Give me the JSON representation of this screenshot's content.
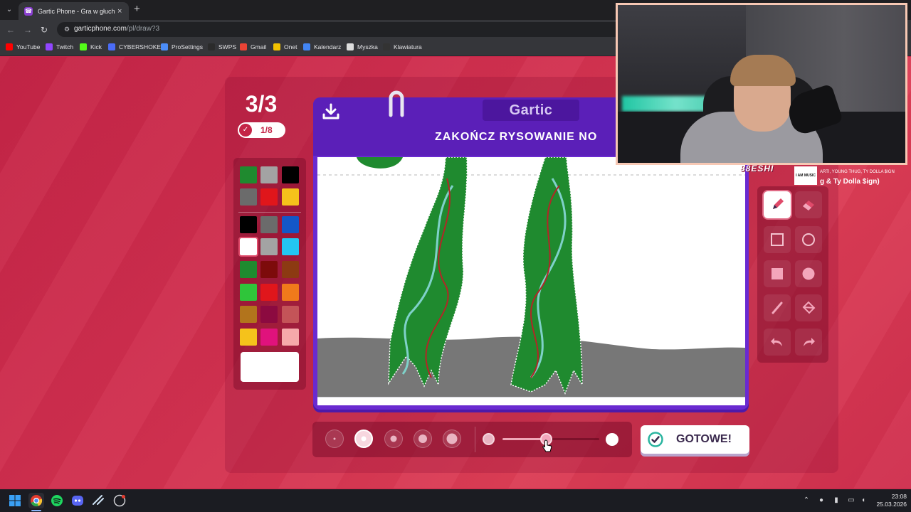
{
  "browser": {
    "tab_title": "Gartic Phone - Gra w głuchy te",
    "tab_close": "×",
    "new_tab": "+",
    "url_host": "garticphone.com",
    "url_path": "/pl/draw?3",
    "bookmarks": [
      {
        "label": "YouTube",
        "icon": "youtube-icon",
        "color": "#ff0000"
      },
      {
        "label": "Twitch",
        "icon": "twitch-icon",
        "color": "#9146ff"
      },
      {
        "label": "Kick",
        "icon": "kick-icon",
        "color": "#53fc18"
      },
      {
        "label": "CYBERSHOKE",
        "icon": "cybershoke-icon",
        "color": "#4a6cf7"
      },
      {
        "label": "ProSettings",
        "icon": "gear-icon",
        "color": "#4b8df8"
      },
      {
        "label": "SWPS",
        "icon": "swps-icon",
        "color": "#2b2b2b"
      },
      {
        "label": "Gmail",
        "icon": "gmail-icon",
        "color": "#ea4335"
      },
      {
        "label": "Onet",
        "icon": "onet-icon",
        "color": "#f2c200"
      },
      {
        "label": "Kalendarz",
        "icon": "calendar-icon",
        "color": "#4285f4"
      },
      {
        "label": "Myszka",
        "icon": "pen-icon",
        "color": "#dddddd"
      },
      {
        "label": "Klawiatura",
        "icon": "keyboard-icon",
        "color": "#333333"
      }
    ]
  },
  "game": {
    "round": "3/3",
    "done_count": "1/8",
    "logo": "Gartic",
    "task": "ZAKOŃCZ RYSOWANIE NO",
    "done_button": "GOTOWE!",
    "colors": {
      "brand_purple": "#6a2ad0",
      "background": "#c8284a"
    },
    "palette": [
      "#1f8a2f",
      "#a3a3a3",
      "#000000",
      "#6b6b6b",
      "#e0161b",
      "#f5c21b",
      "#000000",
      "#6b6b6b",
      "#1357c7",
      "#ffffff",
      "#a3a3a3",
      "#23c6f2",
      "#1f8a2f",
      "#7d0b0b",
      "#8c3a12",
      "#2fc53a",
      "#e0161b",
      "#f07a1b",
      "#b2741c",
      "#8c0a40",
      "#c45458",
      "#f5c21b",
      "#e0127c",
      "#f6a9aa"
    ],
    "selected_color": "#ffffff",
    "opacity_percent": 45,
    "tools": [
      {
        "name": "pen-tool",
        "icon": "pencil-icon",
        "selected": true
      },
      {
        "name": "eraser-tool",
        "icon": "eraser-icon",
        "selected": false
      },
      {
        "name": "rectangle-tool",
        "icon": "square-outline-icon",
        "selected": false
      },
      {
        "name": "ellipse-tool",
        "icon": "circle-outline-icon",
        "selected": false
      },
      {
        "name": "filled-rectangle-tool",
        "icon": "square-filled-icon",
        "selected": false
      },
      {
        "name": "filled-ellipse-tool",
        "icon": "circle-filled-icon",
        "selected": false
      },
      {
        "name": "line-tool",
        "icon": "line-icon",
        "selected": false
      },
      {
        "name": "fill-tool",
        "icon": "bucket-icon",
        "selected": false
      },
      {
        "name": "undo-tool",
        "icon": "undo-icon",
        "selected": false
      },
      {
        "name": "redo-tool",
        "icon": "redo-icon",
        "selected": false
      }
    ]
  },
  "overlay": {
    "music_name": "88ESHI",
    "music_cover": "I AM MUSIC",
    "music_artists": "ARTI, YOUNG THUG, TY DOLLA $IGN",
    "music_song": "g & Ty Dolla $ign)"
  },
  "taskbar": {
    "time": "23:08",
    "date": "25.03.2026"
  }
}
